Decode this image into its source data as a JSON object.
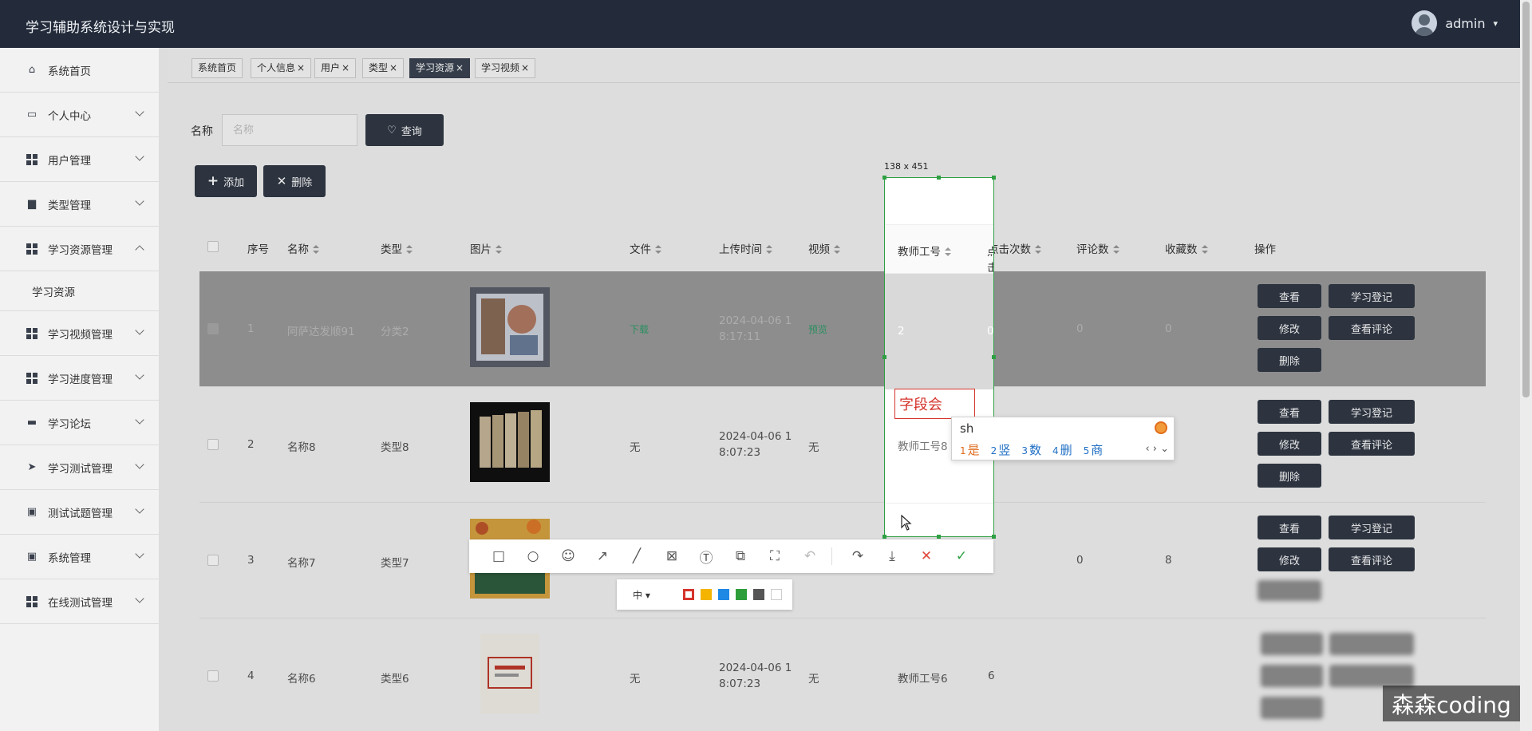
{
  "header": {
    "title": "学习辅助系统设计与实现",
    "username": "admin",
    "caret": "▾"
  },
  "sidebar": {
    "items": [
      {
        "label": "系统首页"
      },
      {
        "label": "个人中心"
      },
      {
        "label": "用户管理"
      },
      {
        "label": "类型管理"
      },
      {
        "label": "学习资源管理"
      },
      {
        "label": "学习视频管理"
      },
      {
        "label": "学习进度管理"
      },
      {
        "label": "学习论坛"
      },
      {
        "label": "学习测试管理"
      },
      {
        "label": "测试试题管理"
      },
      {
        "label": "系统管理"
      },
      {
        "label": "在线测试管理"
      }
    ],
    "submenu": "学习资源"
  },
  "tabs": [
    {
      "label": "系统首页"
    },
    {
      "label": "个人信息"
    },
    {
      "label": "用户"
    },
    {
      "label": "类型"
    },
    {
      "label": "学习资源"
    },
    {
      "label": "学习视频"
    }
  ],
  "tab_close": "×",
  "search": {
    "label": "名称",
    "placeholder": "名称",
    "button": "查询"
  },
  "actions": {
    "add": "添加",
    "delete": "删除"
  },
  "table": {
    "columns": [
      "序号",
      "名称",
      "类型",
      "图片",
      "文件",
      "上传时间",
      "视频",
      "教师工号",
      "点击次数",
      "评论数",
      "收藏数",
      "操作"
    ],
    "rows": [
      {
        "index": "1",
        "name": "阿萨达发顺91",
        "type": "分类2",
        "file": "下载",
        "time1": "2024-04-06 1",
        "time2": "8:17:11",
        "video": "预览",
        "teacher": "2",
        "clicks": "0",
        "comments": "0",
        "favorites": "0"
      },
      {
        "index": "2",
        "name": "名称8",
        "type": "类型8",
        "file": "无",
        "time1": "2024-04-06 1",
        "time2": "8:07:23",
        "video": "无",
        "teacher": "教师工号8",
        "clicks": "",
        "comments": "",
        "favorites": ""
      },
      {
        "index": "3",
        "name": "名称7",
        "type": "类型7",
        "file": "",
        "time1": "",
        "time2": "",
        "video": "",
        "teacher": "",
        "clicks": "",
        "comments": "0",
        "favorites": "8"
      },
      {
        "index": "4",
        "name": "名称6",
        "type": "类型6",
        "file": "无",
        "time1": "2024-04-06 1",
        "time2": "8:07:23",
        "video": "无",
        "teacher": "教师工号6",
        "clicks": "6",
        "comments": "",
        "favorites": ""
      }
    ],
    "op_labels": {
      "view": "查看",
      "register": "学习登记",
      "edit": "修改",
      "view_comments": "查看评论",
      "delete": "删除"
    }
  },
  "capture": {
    "size_label": "138 x 451",
    "text_box": "字段会",
    "ime": {
      "composition": "sh",
      "candidates": [
        "是",
        "竖",
        "数",
        "删",
        "商"
      ]
    }
  },
  "annot_toolbar": {
    "size_select": "中 ▾",
    "colors": [
      "#d4342c",
      "#f4b400",
      "#1e88e5",
      "#2e9e3a",
      "#555555",
      "#ffffff"
    ]
  },
  "watermark": "森森coding"
}
